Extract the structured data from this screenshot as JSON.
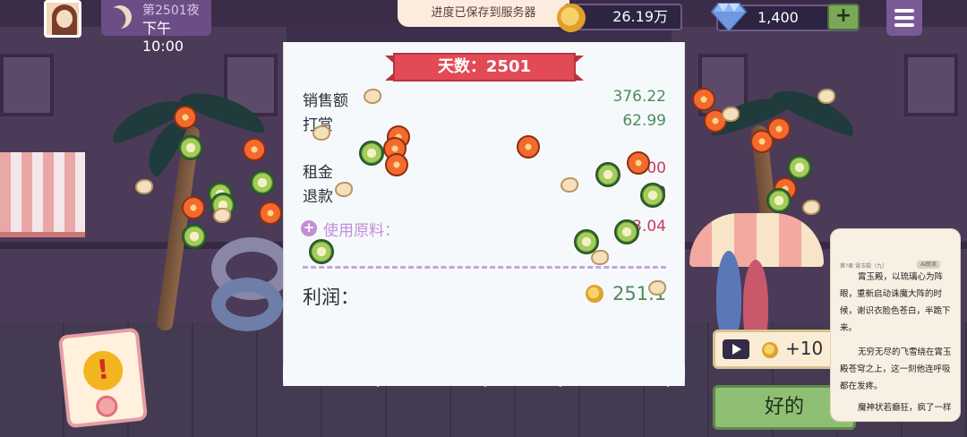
{
  "header": {
    "night_label": "第2501夜",
    "time_label": "下午10:00",
    "toast": "进度已保存到服务器",
    "coins": "26.19万",
    "gems": "1,400",
    "add_label": "+"
  },
  "icons": [
    "avatar",
    "moon-icon",
    "coin-icon",
    "diamond-icon",
    "plus-icon",
    "menu-icon",
    "alert-icon",
    "play-icon"
  ],
  "receipt": {
    "day_title": "天数：2501",
    "rows": [
      {
        "label": "销售额",
        "value": "376.22"
      },
      {
        "label": "打赏",
        "value": "62.99"
      },
      {
        "label": "租金",
        "value": "00"
      },
      {
        "label": "退款",
        "value": "0"
      }
    ],
    "ingredients_label": "使用原料：",
    "ingredients_value": "3.04",
    "profit_label": "利润：",
    "profit_value": "251.1"
  },
  "actions": {
    "ad_reward": "+10",
    "ok_label": "好的"
  },
  "reader": {
    "chapter_head": "第?章 霄玉殿（九）",
    "tag": "AI朗读",
    "p1": "霄玉殿，以琉璃心为阵眼，重新启动诛魔大阵的时候，谢识衣脸色苍白，半跪下来。",
    "p2": "无穷无尽的飞雪绕在霄玉殿苍穹之上，这一刻他连呼吸都在发疼。",
    "p3": "魔神状若癫狂，疯了一样"
  },
  "colors": {
    "accent_green": "#4f8a5b",
    "accent_red": "#c9395c",
    "accent_purple": "#c38ed6",
    "banner_red": "#e24a55"
  }
}
